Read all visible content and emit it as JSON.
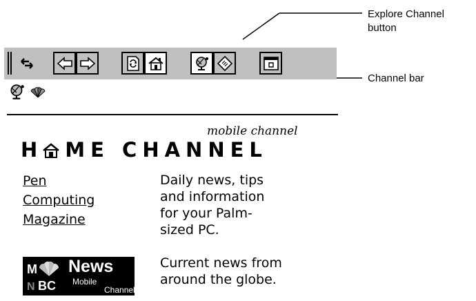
{
  "callouts": {
    "explore_channel": "Explore Channel button",
    "channel_bar": "Channel bar"
  },
  "toolbar": {
    "buttons": [
      {
        "name": "toggle-pane",
        "icon": "swap-arrows-icon"
      },
      {
        "name": "back",
        "icon": "back-arrow-icon"
      },
      {
        "name": "forward",
        "icon": "forward-arrow-icon"
      },
      {
        "name": "refresh",
        "icon": "refresh-icon"
      },
      {
        "name": "home",
        "icon": "home-icon",
        "pressed": true
      },
      {
        "name": "explore-channel",
        "icon": "globe-satellite-icon",
        "pressed": true
      },
      {
        "name": "favorites",
        "icon": "tag-icon"
      },
      {
        "name": "fullscreen",
        "icon": "window-icon"
      }
    ]
  },
  "channel_bar": {
    "items": [
      "globe-satellite-icon",
      "msnbc-peacock-icon"
    ]
  },
  "home": {
    "mobile_channel": "mobile channel",
    "title": "HOME CHANNEL",
    "title_rest": "ME CHANNEL"
  },
  "items": [
    {
      "link_lines": [
        "Pen",
        "Computing",
        "Magazine"
      ],
      "description_lines": [
        "Daily news, tips",
        "and information",
        "for your Palm-",
        "sized PC."
      ]
    },
    {
      "logo_text": {
        "news": "News",
        "mobile": "Mobile",
        "channel": "Channel"
      },
      "description_lines": [
        "Current news from",
        "around the globe."
      ]
    }
  ],
  "colors": {
    "toolbar_bg": "#c0c0c0",
    "pressed_bg": "#ffffff",
    "text": "#000000",
    "logo_bg": "#000000"
  }
}
